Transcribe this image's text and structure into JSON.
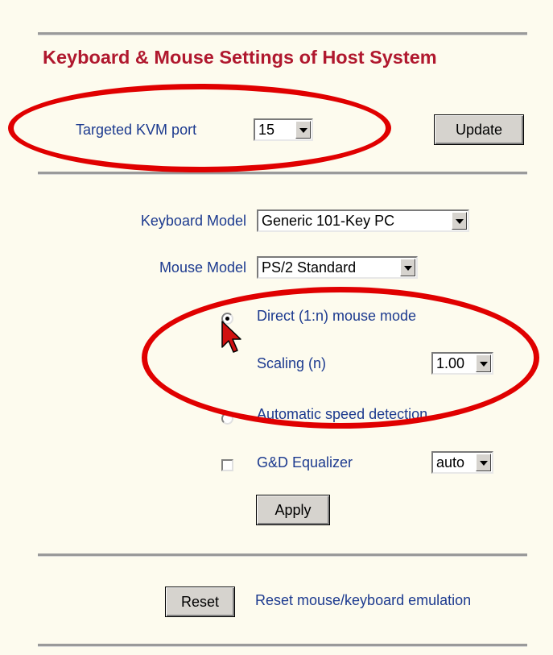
{
  "title": "Keyboard & Mouse Settings of Host System",
  "kvm": {
    "label": "Targeted KVM port",
    "port_value": "15",
    "update_label": "Update"
  },
  "keyboard": {
    "label": "Keyboard Model",
    "value": "Generic 101-Key PC"
  },
  "mouse": {
    "label": "Mouse Model",
    "value": "PS/2 Standard"
  },
  "options": {
    "direct_label": "Direct (1:n) mouse mode",
    "direct_checked": true,
    "scaling_label": "Scaling (n)",
    "scaling_value": "1.00",
    "auto_label": "Automatic speed detection",
    "auto_checked": false,
    "equalizer_label": "G&D Equalizer",
    "equalizer_checked": false,
    "equalizer_value": "auto",
    "apply_label": "Apply"
  },
  "reset": {
    "button_label": "Reset",
    "description": "Reset mouse/keyboard emulation"
  },
  "colors": {
    "title": "#b0182e",
    "label": "#1c3a8f",
    "background": "#fdfbee",
    "highlight_ellipse": "#e00000"
  },
  "icons": {
    "cursor": "mouse-pointer-icon",
    "dropdown": "chevron-down-icon"
  }
}
